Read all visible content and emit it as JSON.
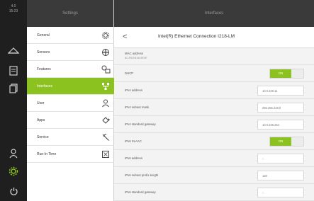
{
  "rail": {
    "top_text": [
      "4.0",
      "15:23"
    ]
  },
  "settings": {
    "header": "Settings",
    "items": [
      {
        "label": "General",
        "icon": "gear-icon"
      },
      {
        "label": "Sensors",
        "icon": "sensor-icon"
      },
      {
        "label": "Features",
        "icon": "features-icon"
      },
      {
        "label": "Interfaces",
        "icon": "network-icon",
        "active": true
      },
      {
        "label": "User",
        "icon": "user-icon"
      },
      {
        "label": "Apps",
        "icon": "apps-icon"
      },
      {
        "label": "Service",
        "icon": "wrench-icon"
      },
      {
        "label": "Run-In Time",
        "icon": "hourglass-icon"
      }
    ]
  },
  "interfaces": {
    "header": "Interfaces",
    "back_label": "<",
    "title": "Intel(R) Ethernet Connection I218-LM",
    "mac": {
      "label": "MAC address",
      "value": "AC:F5:EB:38:3E:5F"
    },
    "dhcp": {
      "label": "DHCP",
      "toggle": "ON"
    },
    "ipv4_address": {
      "label": "IPv4 address",
      "value": "10.0.229.11"
    },
    "ipv4_subnet": {
      "label": "IPv4 subnet mask",
      "value": "255.255.248.0"
    },
    "ipv4_gateway": {
      "label": "IPv4 standard gateway",
      "value": "10.0.239.254"
    },
    "ipv6_slaac": {
      "label": "IPv6 SLAAC",
      "toggle": "ON"
    },
    "ipv6_address": {
      "label": "IPv6 address",
      "value": "::"
    },
    "ipv6_prefix": {
      "label": "IPv6 subnet prefix length",
      "value": "128"
    },
    "ipv6_gateway": {
      "label": "IPv6 standard gateway",
      "value": "::"
    }
  },
  "colors": {
    "accent": "#8cc21f",
    "dark": "#1f1f1f"
  }
}
